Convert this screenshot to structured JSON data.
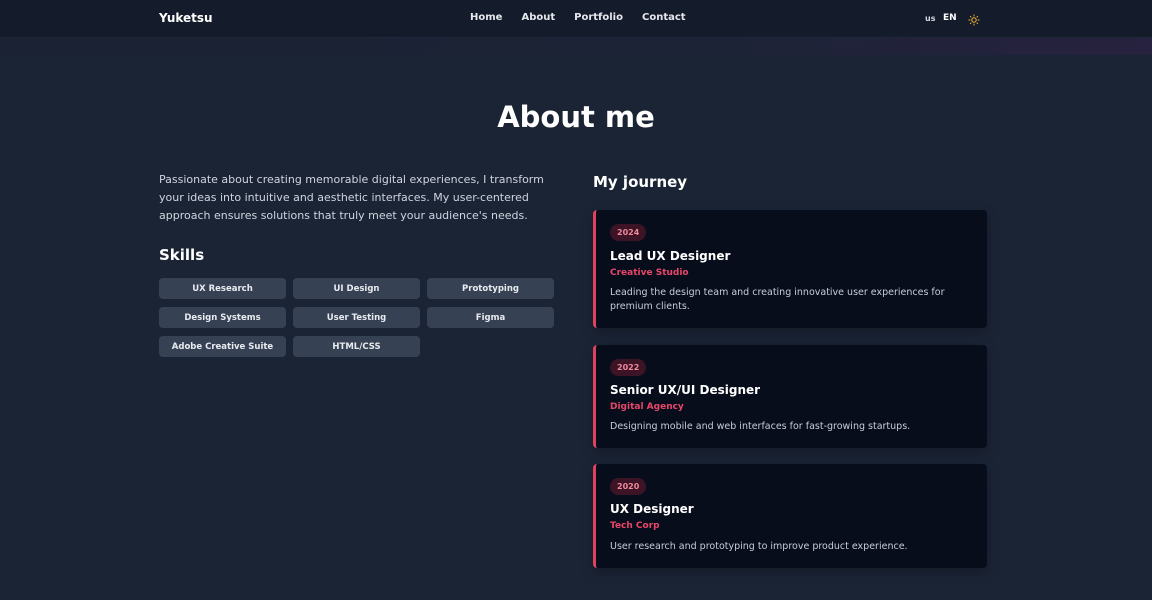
{
  "nav": {
    "brand": "Yuketsu",
    "links": [
      "Home",
      "About",
      "Portfolio",
      "Contact"
    ],
    "lang_flag": "us",
    "lang_code": "EN",
    "theme_icon": "sun-icon"
  },
  "about": {
    "title": "About me",
    "intro": "Passionate about creating memorable digital experiences, I transform your ideas into intuitive and aesthetic interfaces. My user-centered approach ensures solutions that truly meet your audience's needs.",
    "skills_title": "Skills",
    "skills": [
      "UX Research",
      "UI Design",
      "Prototyping",
      "Design Systems",
      "User Testing",
      "Figma",
      "Adobe Creative Suite",
      "HTML/CSS"
    ]
  },
  "journey": {
    "title": "My journey",
    "items": [
      {
        "year": "2024",
        "role": "Lead UX Designer",
        "company": "Creative Studio",
        "desc": "Leading the design team and creating innovative user experiences for premium clients."
      },
      {
        "year": "2022",
        "role": "Senior UX/UI Designer",
        "company": "Digital Agency",
        "desc": "Designing mobile and web interfaces for fast-growing startups."
      },
      {
        "year": "2020",
        "role": "UX Designer",
        "company": "Tech Corp",
        "desc": "User research and prototyping to improve product experience."
      }
    ]
  },
  "colors": {
    "background": "#1b2435",
    "accent": "#e0425e",
    "card": "#080d1c"
  }
}
